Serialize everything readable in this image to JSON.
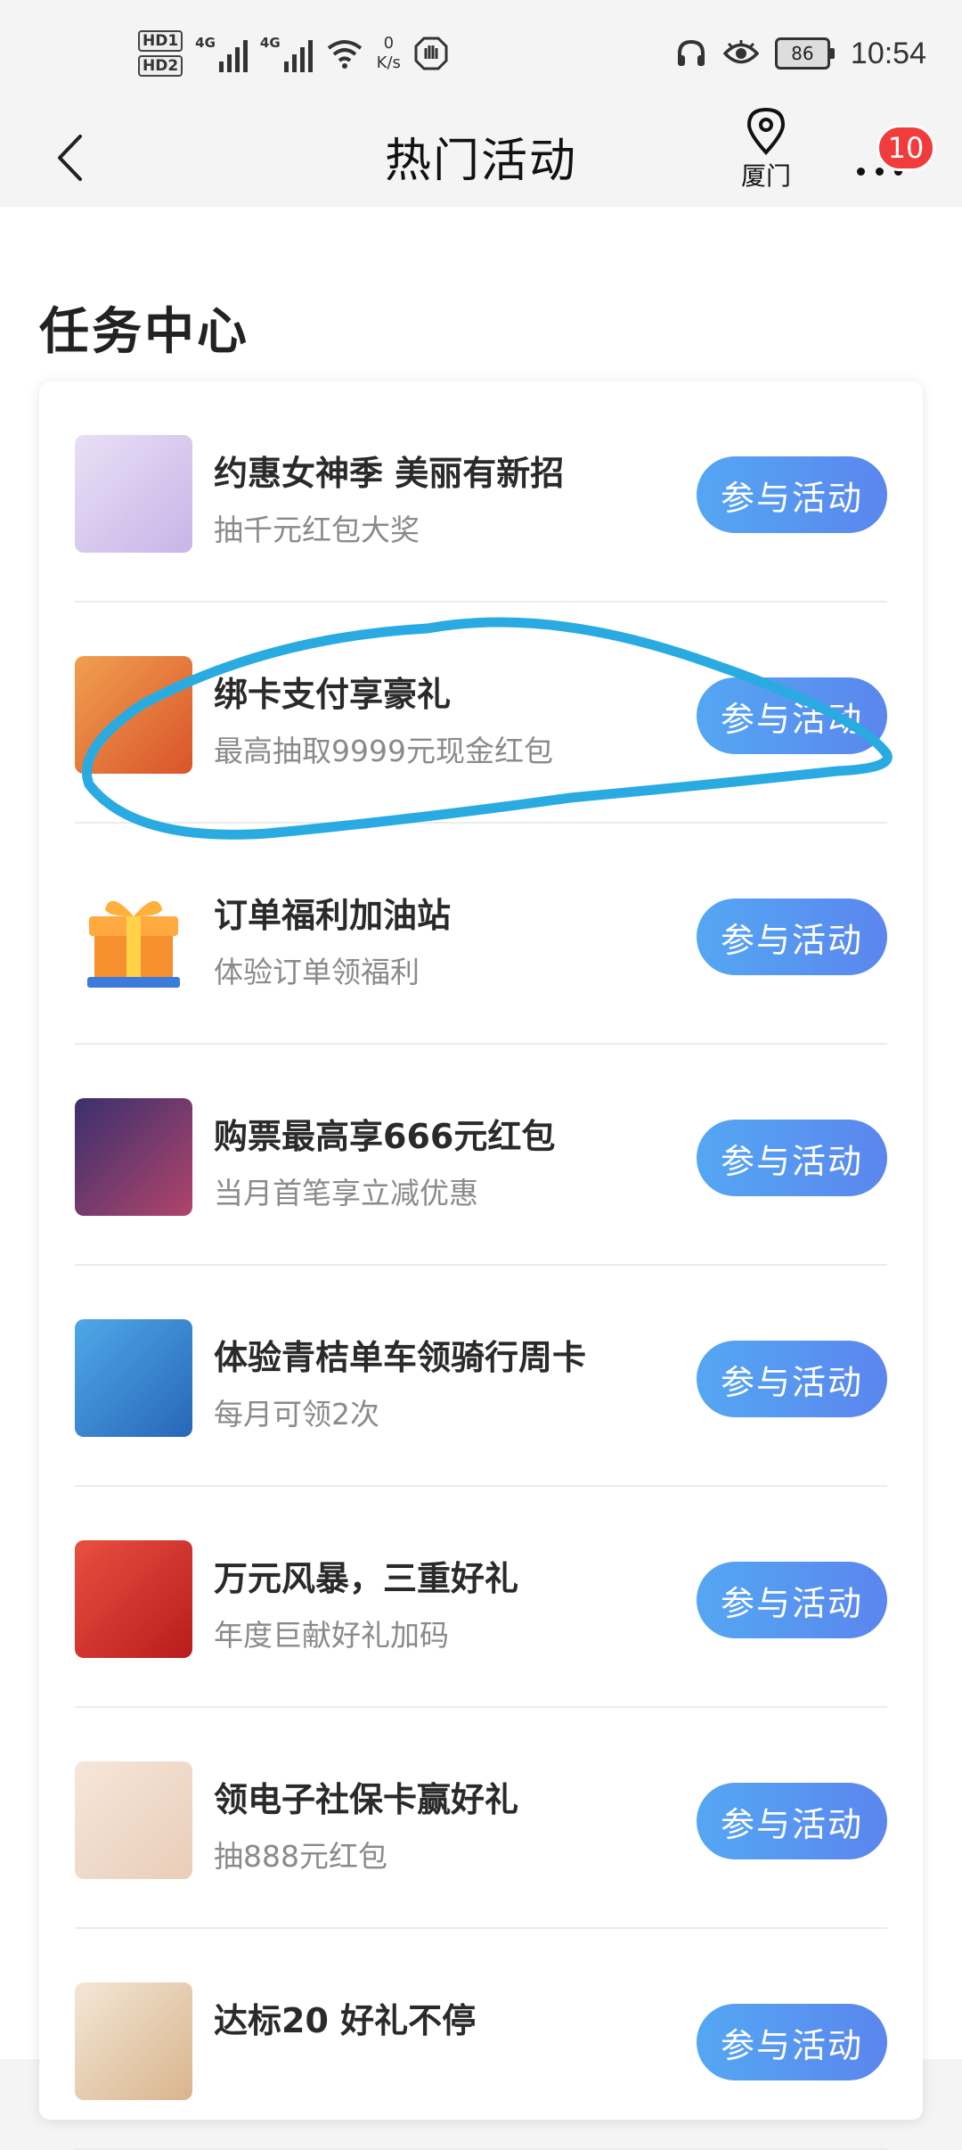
{
  "status_bar": {
    "hd1": "HD1",
    "hd2": "HD2",
    "sim1_type": "4G",
    "sim2_type": "4G",
    "net_speed_value": "0",
    "net_speed_unit": "K/s",
    "battery": "86",
    "time": "10:54"
  },
  "nav": {
    "title": "热门活动",
    "location": "厦门",
    "badge_count": "10"
  },
  "section_title": "任务中心",
  "join_label": "参与活动",
  "activities": [
    {
      "title": "约惠女神季 美丽有新招",
      "subtitle": "抽千元红包大奖",
      "thumb_colors": [
        "#e9dff5",
        "#c8b4e8"
      ]
    },
    {
      "title": "绑卡支付享豪礼",
      "subtitle": "最高抽取9999元现金红包",
      "thumb_colors": [
        "#f0a050",
        "#d9542a"
      ]
    },
    {
      "title": "订单福利加油站",
      "subtitle": "体验订单领福利",
      "thumb_colors": [
        "#ffffff",
        "#ffffff"
      ]
    },
    {
      "title": "购票最高享666元红包",
      "subtitle": "当月首笔享立减优惠",
      "thumb_colors": [
        "#3a2f6e",
        "#b0456a"
      ]
    },
    {
      "title": "体验青桔单车领骑行周卡",
      "subtitle": "每月可领2次",
      "thumb_colors": [
        "#4fa8e8",
        "#2866b8"
      ]
    },
    {
      "title": "万元风暴，三重好礼",
      "subtitle": "年度巨献好礼加码",
      "thumb_colors": [
        "#e85040",
        "#b81c1c"
      ]
    },
    {
      "title": "领电子社保卡赢好礼",
      "subtitle": "抽888元红包",
      "thumb_colors": [
        "#f6e6da",
        "#e9cdb8"
      ]
    },
    {
      "title": "达标20 好礼不停",
      "subtitle": "",
      "thumb_colors": [
        "#f3e7d6",
        "#d9b48c"
      ]
    }
  ],
  "colors": {
    "button_start": "#54a7f3",
    "button_end": "#5b86ee",
    "annotation": "#29abe2",
    "badge": "#f23b3b"
  },
  "icons": [
    "back-arrow-icon",
    "location-pin-icon",
    "more-dots-icon",
    "headset-icon",
    "eye-icon",
    "wifi-icon",
    "signal-icon"
  ]
}
